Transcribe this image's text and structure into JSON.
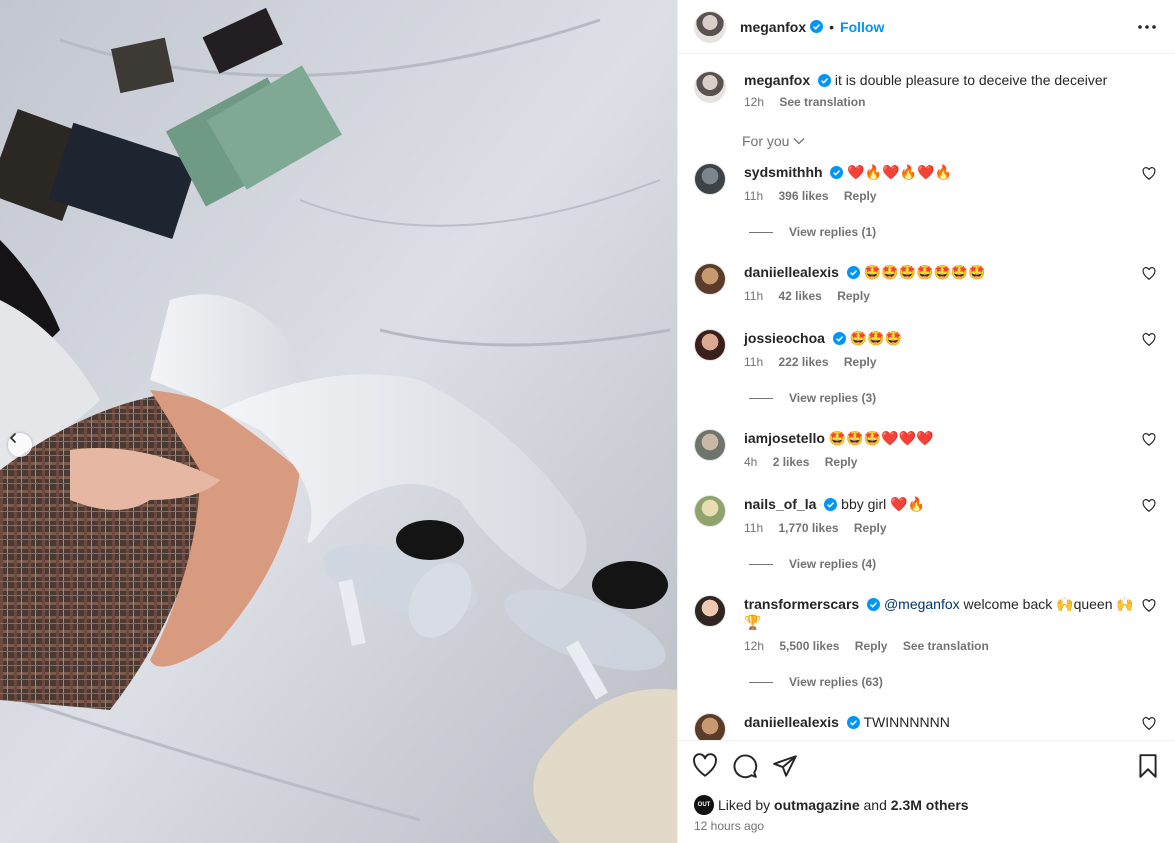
{
  "header": {
    "username": "meganfox",
    "separator": "•",
    "follow_label": "Follow"
  },
  "caption": {
    "username": "meganfox",
    "text": "it is double pleasure to deceive the deceiver",
    "time": "12h",
    "see_translation": "See translation"
  },
  "sort": {
    "label": "For you"
  },
  "comments": [
    {
      "username": "sydsmithhh",
      "text": "❤️🔥❤️🔥❤️🔥",
      "time": "11h",
      "likes": "396 likes",
      "reply": "Reply",
      "view_replies": "View replies (1)"
    },
    {
      "username": "daniiellealexis",
      "text": "🤩🤩🤩🤩🤩🤩🤩",
      "time": "11h",
      "likes": "42 likes",
      "reply": "Reply"
    },
    {
      "username": "jossieochoa",
      "text": "🤩🤩🤩",
      "time": "11h",
      "likes": "222 likes",
      "reply": "Reply",
      "view_replies": "View replies (3)"
    },
    {
      "username": "iamjosetello",
      "text": "🤩🤩🤩❤️❤️❤️",
      "time": "4h",
      "likes": "2 likes",
      "reply": "Reply"
    },
    {
      "username": "nails_of_la",
      "text": "bby girl ❤️🔥",
      "time": "11h",
      "likes": "1,770 likes",
      "reply": "Reply",
      "view_replies": "View replies (4)"
    },
    {
      "username": "transformerscars",
      "mention": "@meganfox",
      "text": " welcome back 🙌queen 🙌",
      "text2": "🏆",
      "time": "12h",
      "likes": "5,500 likes",
      "reply": "Reply",
      "see_translation": "See translation",
      "view_replies": "View replies (63)"
    },
    {
      "username": "daniiellealexis",
      "text": "TWINNNNNN"
    }
  ],
  "footer": {
    "liked_prefix": "Liked by ",
    "liked_user": "outmagazine",
    "liked_mid": " and ",
    "liked_count": "2.3M others",
    "mini_avatar_text": "OUT",
    "time_ago": "12 hours ago"
  },
  "colors": {
    "accent": "#0095f6",
    "verified": "#0095f6",
    "muted": "#737373",
    "text": "#262626"
  },
  "icons": [
    "verified-badge-icon",
    "more-options-icon",
    "chevron-down-icon",
    "heart-icon",
    "comment-icon",
    "share-icon",
    "bookmark-icon",
    "chevron-left-icon"
  ]
}
